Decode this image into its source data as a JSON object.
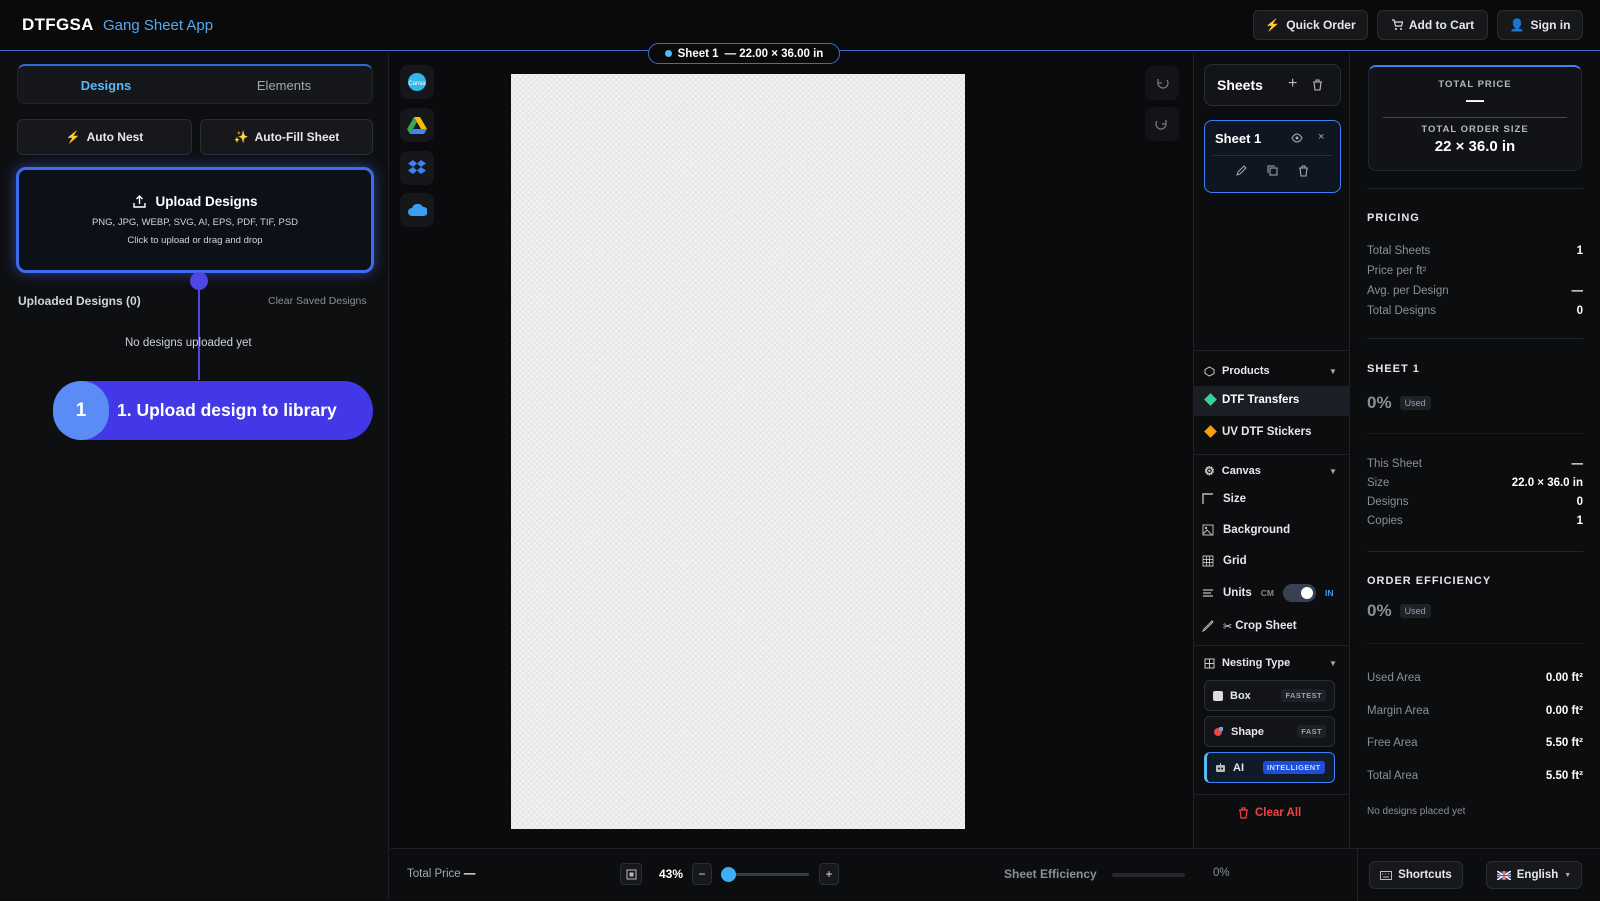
{
  "header": {
    "brand": "DTFGSA",
    "app_name": "Gang Sheet App",
    "quick_order": "Quick Order",
    "add_to_cart": "Add to Cart",
    "sign_in": "Sign in"
  },
  "left": {
    "tabs": [
      "Designs",
      "Elements"
    ],
    "auto_nest": "Auto Nest",
    "auto_fill": "Auto-Fill Sheet",
    "upload_title": "Upload Designs",
    "upload_formats": "PNG, JPG, WEBP, SVG, AI, EPS, PDF, TIF, PSD",
    "upload_hint": "Click to upload or drag and drop",
    "uploaded_label": "Uploaded Designs (0)",
    "clear_saved": "Clear Saved Designs",
    "empty": "No designs uploaded yet",
    "step_number": "1",
    "step_text": "1. Upload design to library"
  },
  "canvas": {
    "sheet_name": "Sheet 1",
    "sheet_dims": "— 22.00 × 36.00 in"
  },
  "sheets": {
    "title": "Sheets",
    "sheet_name": "Sheet 1"
  },
  "products": {
    "title": "Products",
    "items": [
      "DTF Transfers",
      "UV DTF Stickers"
    ]
  },
  "canvas_menu": {
    "title": "Canvas",
    "size": "Size",
    "background": "Background",
    "grid": "Grid",
    "units": "Units",
    "unit_cm": "CM",
    "unit_in": "IN",
    "crop": "Crop Sheet"
  },
  "nesting": {
    "title": "Nesting Type",
    "options": [
      {
        "label": "Box",
        "tag": "FASTEST"
      },
      {
        "label": "Shape",
        "tag": "FAST"
      },
      {
        "label": "AI",
        "tag": "INTELLIGENT"
      }
    ],
    "clear_all": "Clear All"
  },
  "summary": {
    "total_price_label": "TOTAL PRICE",
    "total_price_value": "—",
    "order_size_label": "TOTAL ORDER SIZE",
    "order_size_value": "22 × 36.0 in",
    "pricing_title": "PRICING",
    "pricing": [
      {
        "k": "Total Sheets",
        "v": "1"
      },
      {
        "k": "Price per ft²",
        "v": ""
      },
      {
        "k": "Avg. per Design",
        "v": "—"
      },
      {
        "k": "Total Designs",
        "v": "0"
      }
    ],
    "sheet_title": "SHEET 1",
    "sheet_used_pct": "0%",
    "used_tag": "Used",
    "sheet_stats": [
      {
        "k": "This Sheet",
        "v": "—"
      },
      {
        "k": "Size",
        "v": "22.0 × 36.0 in"
      },
      {
        "k": "Designs",
        "v": "0"
      },
      {
        "k": "Copies",
        "v": "1"
      }
    ],
    "efficiency_title": "ORDER EFFICIENCY",
    "efficiency_pct": "0%",
    "areas": [
      {
        "k": "Used Area",
        "v": "0.00 ft²"
      },
      {
        "k": "Margin Area",
        "v": "0.00 ft²"
      },
      {
        "k": "Free Area",
        "v": "5.50 ft²"
      },
      {
        "k": "Total Area",
        "v": "5.50 ft²"
      }
    ],
    "none_placed": "No designs placed yet"
  },
  "bottom": {
    "total_price_label": "Total Price",
    "total_price_value": "—",
    "zoom": "43%",
    "zoom_fraction": 0.08,
    "efficiency_label": "Sheet Efficiency",
    "efficiency_value": "0%",
    "shortcuts": "Shortcuts",
    "language": "English"
  },
  "colors": {
    "accent": "#3d6cf0",
    "brand_blue": "#5aa8f0",
    "danger": "#ef4444"
  }
}
